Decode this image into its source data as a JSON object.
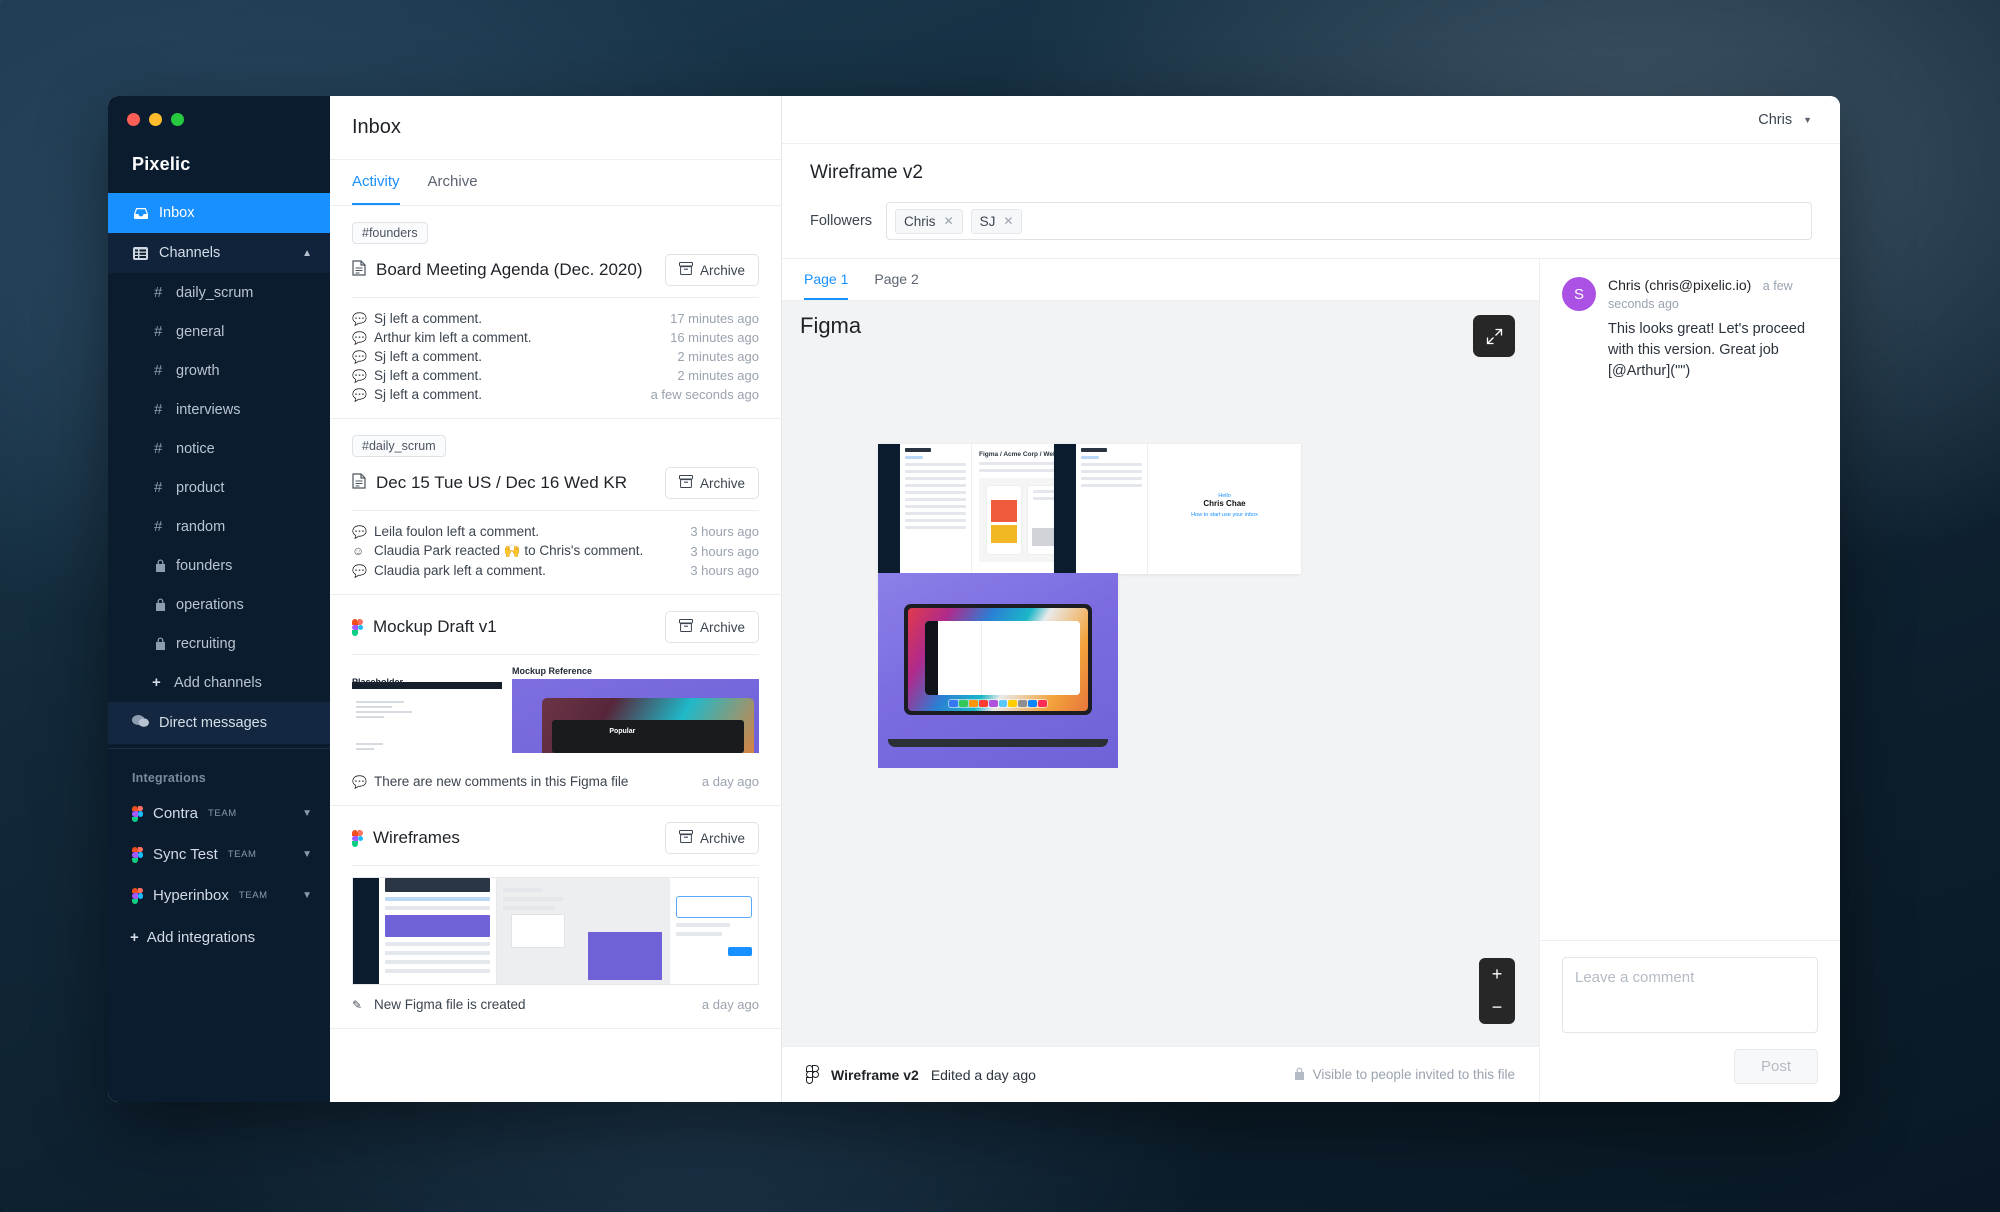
{
  "window": {
    "traffic_lights": [
      "close",
      "minimize",
      "maximize"
    ],
    "brand": "Pixelic"
  },
  "sidebar": {
    "inbox_label": "Inbox",
    "channels_label": "Channels",
    "channels": [
      {
        "name": "daily_scrum",
        "icon": "hash-icon"
      },
      {
        "name": "general",
        "icon": "hash-icon"
      },
      {
        "name": "growth",
        "icon": "hash-icon"
      },
      {
        "name": "interviews",
        "icon": "hash-icon"
      },
      {
        "name": "notice",
        "icon": "hash-icon"
      },
      {
        "name": "product",
        "icon": "hash-icon"
      },
      {
        "name": "random",
        "icon": "hash-icon"
      },
      {
        "name": "founders",
        "icon": "lock-icon"
      },
      {
        "name": "operations",
        "icon": "lock-icon"
      },
      {
        "name": "recruiting",
        "icon": "lock-icon"
      }
    ],
    "add_channels_label": "Add channels",
    "direct_messages_label": "Direct messages",
    "integrations_label": "Integrations",
    "integrations": [
      {
        "name": "Contra",
        "badge": "TEAM",
        "icon": "figma-icon"
      },
      {
        "name": "Sync Test",
        "badge": "TEAM",
        "icon": "figma-icon"
      },
      {
        "name": "Hyperinbox",
        "badge": "TEAM",
        "icon": "figma-icon"
      }
    ],
    "add_integrations_label": "Add integrations"
  },
  "inbox": {
    "title": "Inbox",
    "tabs": [
      {
        "label": "Activity",
        "active": true
      },
      {
        "label": "Archive",
        "active": false
      }
    ],
    "archive_button_label": "Archive",
    "cards": [
      {
        "channel": "#founders",
        "title": "Board Meeting Agenda (Dec. 2020)",
        "icon": "document-icon",
        "events": [
          {
            "icon": "comment-icon",
            "text": "Sj left a comment.",
            "time": "17 minutes ago"
          },
          {
            "icon": "comment-icon",
            "text": "Arthur kim left a comment.",
            "time": "16 minutes ago"
          },
          {
            "icon": "comment-icon",
            "text": "Sj left a comment.",
            "time": "2 minutes ago"
          },
          {
            "icon": "comment-icon",
            "text": "Sj left a comment.",
            "time": "2 minutes ago"
          },
          {
            "icon": "comment-icon",
            "text": "Sj left a comment.",
            "time": "a few seconds ago"
          }
        ]
      },
      {
        "channel": "#daily_scrum",
        "title": "Dec 15 Tue US / Dec 16 Wed KR",
        "icon": "document-icon",
        "events": [
          {
            "icon": "comment-icon",
            "text": "Leila foulon left a comment.",
            "time": "3 hours ago"
          },
          {
            "icon": "emoji-icon",
            "text": "Claudia Park reacted 🙌 to Chris's comment.",
            "time": "3 hours ago"
          },
          {
            "icon": "comment-icon",
            "text": "Claudia park left a comment.",
            "time": "3 hours ago"
          }
        ]
      },
      {
        "channel": "",
        "title": "Mockup Draft v1",
        "icon": "figma-icon",
        "thumb_caption_left": "Placeholder",
        "thumb_caption_right": "Mockup Reference",
        "thumb_popular_label": "Popular",
        "events": [
          {
            "icon": "comment-icon",
            "text": "There are new comments in this Figma file",
            "time": "a day ago"
          }
        ]
      },
      {
        "channel": "",
        "title": "Wireframes",
        "icon": "figma-icon",
        "events": [
          {
            "icon": "pencil-icon",
            "text": "New Figma file is created",
            "time": "a day ago"
          }
        ]
      }
    ]
  },
  "topbar": {
    "user_name": "Chris",
    "caret_icon": "chevron-down-icon"
  },
  "detail": {
    "title": "Wireframe v2",
    "followers_label": "Followers",
    "followers": [
      {
        "name": "Chris",
        "remove_icon": "close-icon"
      },
      {
        "name": "SJ",
        "remove_icon": "close-icon"
      }
    ],
    "page_tabs": [
      {
        "label": "Page 1",
        "active": true
      },
      {
        "label": "Page 2",
        "active": false
      }
    ],
    "canvas": {
      "label": "Figma",
      "fullscreen_icon": "expand-icon",
      "zoom_in_label": "+",
      "zoom_out_label": "−",
      "artboard_1_title": "Figma / Acme Corp / Website Design",
      "artboard_1_inbox": "Inbox",
      "artboard_2_inbox": "Inbox",
      "artboard_2_hello_prefix": "Hello ",
      "artboard_2_hello_name": "Chris Chae",
      "artboard_2_hello_link": "How to start use your inbox"
    },
    "file_bar": {
      "icon": "figma-icon",
      "file_name": "Wireframe v2",
      "edited_text": "Edited a day ago",
      "lock_icon": "lock-icon",
      "visibility_text": "Visible to people invited to this file"
    }
  },
  "comments": {
    "items": [
      {
        "avatar_initial": "S",
        "avatar_color": "#ab51e3",
        "author": "Chris (chris@pixelic.io)",
        "time": "a few seconds ago",
        "text": "This looks great! Let's proceed with this version. Great job [@Arthur](\"\")"
      }
    ],
    "compose_placeholder": "Leave a comment",
    "compose_value": "",
    "post_label": "Post"
  },
  "colors": {
    "accent": "#1890ff",
    "sidebar_bg": "#0b1c2e",
    "avatar": "#ab51e3"
  }
}
